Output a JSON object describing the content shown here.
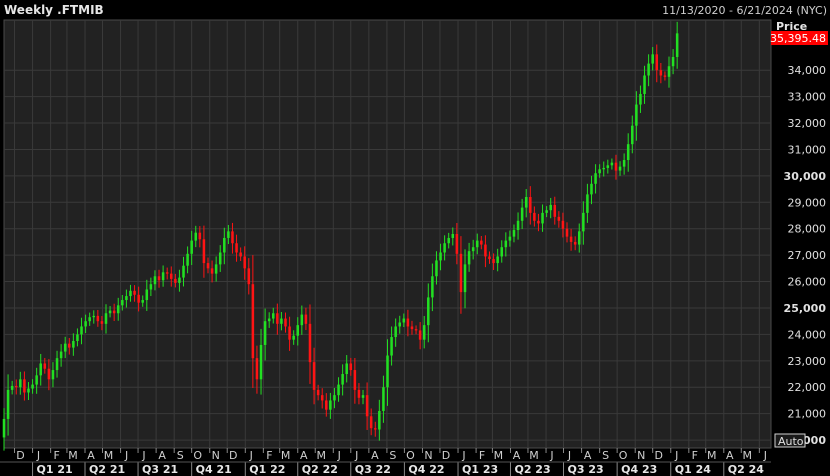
{
  "header": {
    "title": "Weekly .FTMIB",
    "date_range": "11/13/2020 - 6/21/2024 (NYC)"
  },
  "price_axis": {
    "label": "Price",
    "last_price_label": "35,395.48",
    "auto_label": "Auto"
  },
  "colors": {
    "background": "#000000",
    "plot_background": "#222222",
    "grid": "#3a3a3a",
    "up": "#22e022",
    "down": "#ff1414",
    "last_price_bg": "#ff0000"
  },
  "chart_data": {
    "type": "candlestick",
    "title": "Weekly .FTMIB",
    "ylabel": "Price",
    "ylim": [
      19700,
      35900
    ],
    "yticks": [
      20000,
      21000,
      22000,
      23000,
      24000,
      25000,
      26000,
      27000,
      28000,
      29000,
      30000,
      31000,
      32000,
      33000,
      34000
    ],
    "ytick_labels": [
      "20,000",
      "21,000",
      "22,000",
      "23,000",
      "24,000",
      "25,000",
      "26,000",
      "27,000",
      "28,000",
      "29,000",
      "30,000",
      "31,000",
      "32,000",
      "33,000",
      "34,000"
    ],
    "bold_ytick_labels": [
      "20,000",
      "25,000",
      "30,000"
    ],
    "xlim": [
      "2020-11-13",
      "2024-06-21"
    ],
    "month_labels": [
      {
        "label": "D",
        "date": "2020-12-01"
      },
      {
        "label": "J",
        "date": "2021-01-01"
      },
      {
        "label": "F",
        "date": "2021-02-01"
      },
      {
        "label": "M",
        "date": "2021-03-01"
      },
      {
        "label": "A",
        "date": "2021-04-01"
      },
      {
        "label": "M",
        "date": "2021-05-01"
      },
      {
        "label": "J",
        "date": "2021-06-01"
      },
      {
        "label": "J",
        "date": "2021-07-01"
      },
      {
        "label": "A",
        "date": "2021-08-01"
      },
      {
        "label": "S",
        "date": "2021-09-01"
      },
      {
        "label": "O",
        "date": "2021-10-01"
      },
      {
        "label": "N",
        "date": "2021-11-01"
      },
      {
        "label": "D",
        "date": "2021-12-01"
      },
      {
        "label": "J",
        "date": "2022-01-01"
      },
      {
        "label": "F",
        "date": "2022-02-01"
      },
      {
        "label": "M",
        "date": "2022-03-01"
      },
      {
        "label": "A",
        "date": "2022-04-01"
      },
      {
        "label": "M",
        "date": "2022-05-01"
      },
      {
        "label": "J",
        "date": "2022-06-01"
      },
      {
        "label": "J",
        "date": "2022-07-01"
      },
      {
        "label": "A",
        "date": "2022-08-01"
      },
      {
        "label": "S",
        "date": "2022-09-01"
      },
      {
        "label": "O",
        "date": "2022-10-01"
      },
      {
        "label": "N",
        "date": "2022-11-01"
      },
      {
        "label": "D",
        "date": "2022-12-01"
      },
      {
        "label": "J",
        "date": "2023-01-01"
      },
      {
        "label": "F",
        "date": "2023-02-01"
      },
      {
        "label": "M",
        "date": "2023-03-01"
      },
      {
        "label": "A",
        "date": "2023-04-01"
      },
      {
        "label": "M",
        "date": "2023-05-01"
      },
      {
        "label": "J",
        "date": "2023-06-01"
      },
      {
        "label": "J",
        "date": "2023-07-01"
      },
      {
        "label": "A",
        "date": "2023-08-01"
      },
      {
        "label": "S",
        "date": "2023-09-01"
      },
      {
        "label": "O",
        "date": "2023-10-01"
      },
      {
        "label": "N",
        "date": "2023-11-01"
      },
      {
        "label": "D",
        "date": "2023-12-01"
      },
      {
        "label": "J",
        "date": "2024-01-01"
      },
      {
        "label": "F",
        "date": "2024-02-01"
      },
      {
        "label": "M",
        "date": "2024-03-01"
      },
      {
        "label": "A",
        "date": "2024-04-01"
      },
      {
        "label": "M",
        "date": "2024-05-01"
      },
      {
        "label": "J",
        "date": "2024-06-01"
      }
    ],
    "quarter_labels": [
      {
        "label": "Q1 21",
        "start": "2021-01-01"
      },
      {
        "label": "Q2 21",
        "start": "2021-04-01"
      },
      {
        "label": "Q3 21",
        "start": "2021-07-01"
      },
      {
        "label": "Q4 21",
        "start": "2021-10-01"
      },
      {
        "label": "Q1 22",
        "start": "2022-01-01"
      },
      {
        "label": "Q2 22",
        "start": "2022-04-01"
      },
      {
        "label": "Q3 22",
        "start": "2022-07-01"
      },
      {
        "label": "Q4 22",
        "start": "2022-10-01"
      },
      {
        "label": "Q1 23",
        "start": "2023-01-01"
      },
      {
        "label": "Q2 23",
        "start": "2023-04-01"
      },
      {
        "label": "Q3 23",
        "start": "2023-07-01"
      },
      {
        "label": "Q4 23",
        "start": "2023-10-01"
      },
      {
        "label": "Q1 24",
        "start": "2024-01-01"
      },
      {
        "label": "Q2 24",
        "start": "2024-04-01"
      }
    ],
    "last_price": 35395.48,
    "first_week": "2020-11-13",
    "weekly_closes": [
      20800,
      21900,
      22050,
      22000,
      22300,
      21800,
      21950,
      22100,
      22450,
      22900,
      22700,
      22300,
      22650,
      23100,
      23350,
      23650,
      23500,
      23750,
      24000,
      24300,
      24500,
      24650,
      24700,
      24500,
      24400,
      24800,
      24900,
      24800,
      25100,
      25300,
      25450,
      25650,
      25500,
      25200,
      25300,
      25700,
      25900,
      26200,
      26050,
      26350,
      26300,
      26100,
      25950,
      26150,
      26600,
      27050,
      27550,
      27850,
      27600,
      26700,
      26500,
      26300,
      26650,
      27100,
      27650,
      27900,
      27450,
      27100,
      26950,
      26500,
      25900,
      23100,
      22300,
      23600,
      24500,
      24600,
      24800,
      24400,
      24600,
      24300,
      23800,
      23950,
      24350,
      24750,
      24400,
      22950,
      21900,
      21700,
      21500,
      21150,
      21500,
      21700,
      22100,
      22500,
      22900,
      22650,
      21900,
      21600,
      21700,
      20900,
      20450,
      20400,
      21100,
      22000,
      23200,
      23900,
      24300,
      24450,
      24600,
      24300,
      24200,
      24150,
      23800,
      24350,
      25400,
      26200,
      26800,
      27100,
      27450,
      27650,
      27800,
      27050,
      25600,
      26650,
      27150,
      27300,
      27550,
      27400,
      26950,
      26850,
      26700,
      26950,
      27300,
      27550,
      27700,
      27950,
      28300,
      28800,
      29200,
      28600,
      28300,
      28200,
      28600,
      28700,
      28900,
      28450,
      28300,
      28000,
      27700,
      27500,
      27400,
      27900,
      28600,
      29300,
      29700,
      30100,
      30250,
      30300,
      30400,
      30500,
      30200,
      30350,
      30600,
      31200,
      31900,
      32700,
      33100,
      33800,
      34250,
      34600,
      34000,
      33800,
      33750,
      34150,
      34500,
      35395
    ]
  }
}
